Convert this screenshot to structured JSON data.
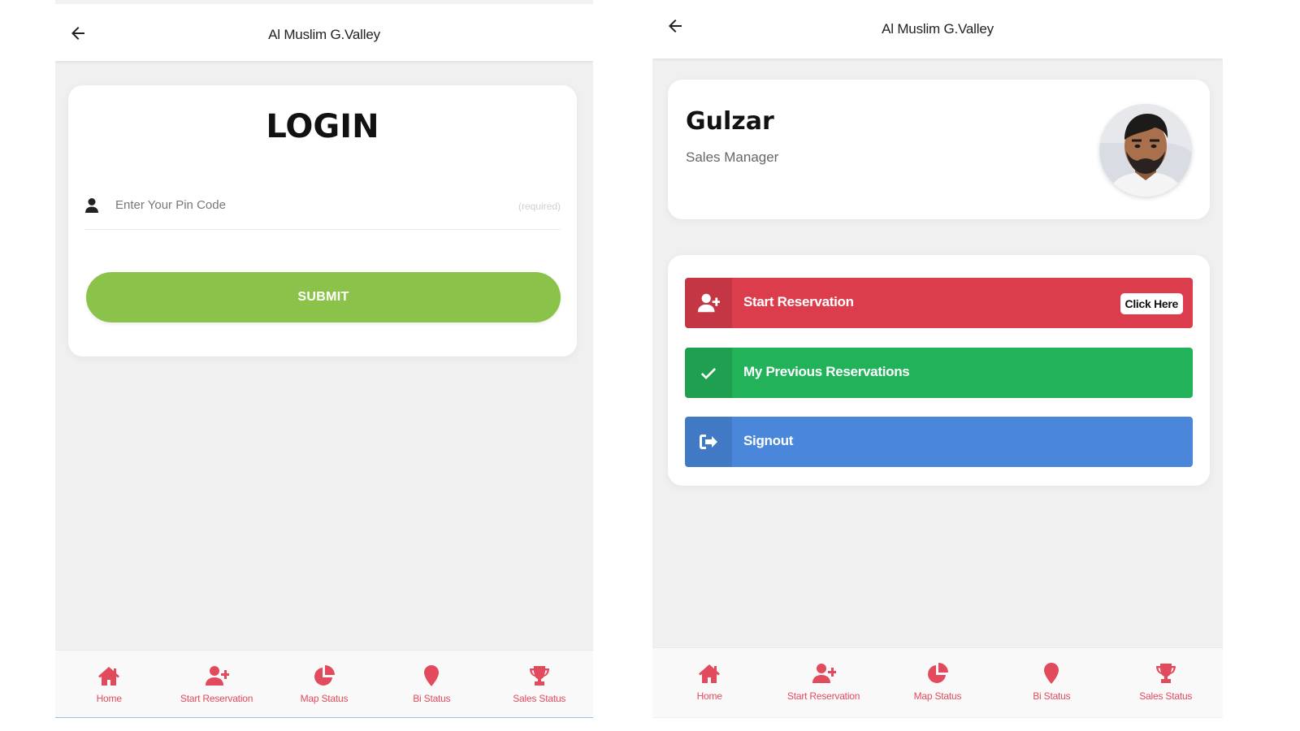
{
  "colors": {
    "accent_red": "#dc3d4d",
    "accent_green": "#22b35a",
    "accent_blue": "#4a87db",
    "submit_green": "#8bc34a",
    "nav_red": "#e24b5d"
  },
  "left_screen": {
    "header": {
      "title": "Al Muslim G.Valley",
      "back_icon": "arrow-left-icon"
    },
    "login": {
      "title": "LOGIN",
      "pin_icon": "user-icon",
      "pin_placeholder": "Enter Your Pin Code",
      "pin_value": "",
      "pin_hint": "(required)",
      "submit_label": "SUBMIT"
    },
    "bottom_nav": [
      {
        "label": "Home",
        "icon": "home-icon"
      },
      {
        "label": "Start Reservation",
        "icon": "user-plus-icon"
      },
      {
        "label": "Map Status",
        "icon": "pie-chart-icon"
      },
      {
        "label": "Bi Status",
        "icon": "map-marker-icon"
      },
      {
        "label": "Sales Status",
        "icon": "trophy-icon"
      }
    ]
  },
  "right_screen": {
    "header": {
      "title": "Al Muslim G.Valley",
      "back_icon": "arrow-left-icon"
    },
    "profile": {
      "name": "Gulzar",
      "role": "Sales Manager",
      "avatar_icon": "avatar-photo"
    },
    "menu": {
      "start_reservation": {
        "label": "Start Reservation",
        "badge": "Click Here",
        "icon": "user-plus-icon"
      },
      "previous_reservations": {
        "label": "My Previous Reservations",
        "icon": "check-icon"
      },
      "signout": {
        "label": "Signout",
        "icon": "sign-out-icon"
      }
    },
    "bottom_nav": [
      {
        "label": "Home",
        "icon": "home-icon"
      },
      {
        "label": "Start Reservation",
        "icon": "user-plus-icon"
      },
      {
        "label": "Map Status",
        "icon": "pie-chart-icon"
      },
      {
        "label": "Bi Status",
        "icon": "map-marker-icon"
      },
      {
        "label": "Sales Status",
        "icon": "trophy-icon"
      }
    ]
  }
}
